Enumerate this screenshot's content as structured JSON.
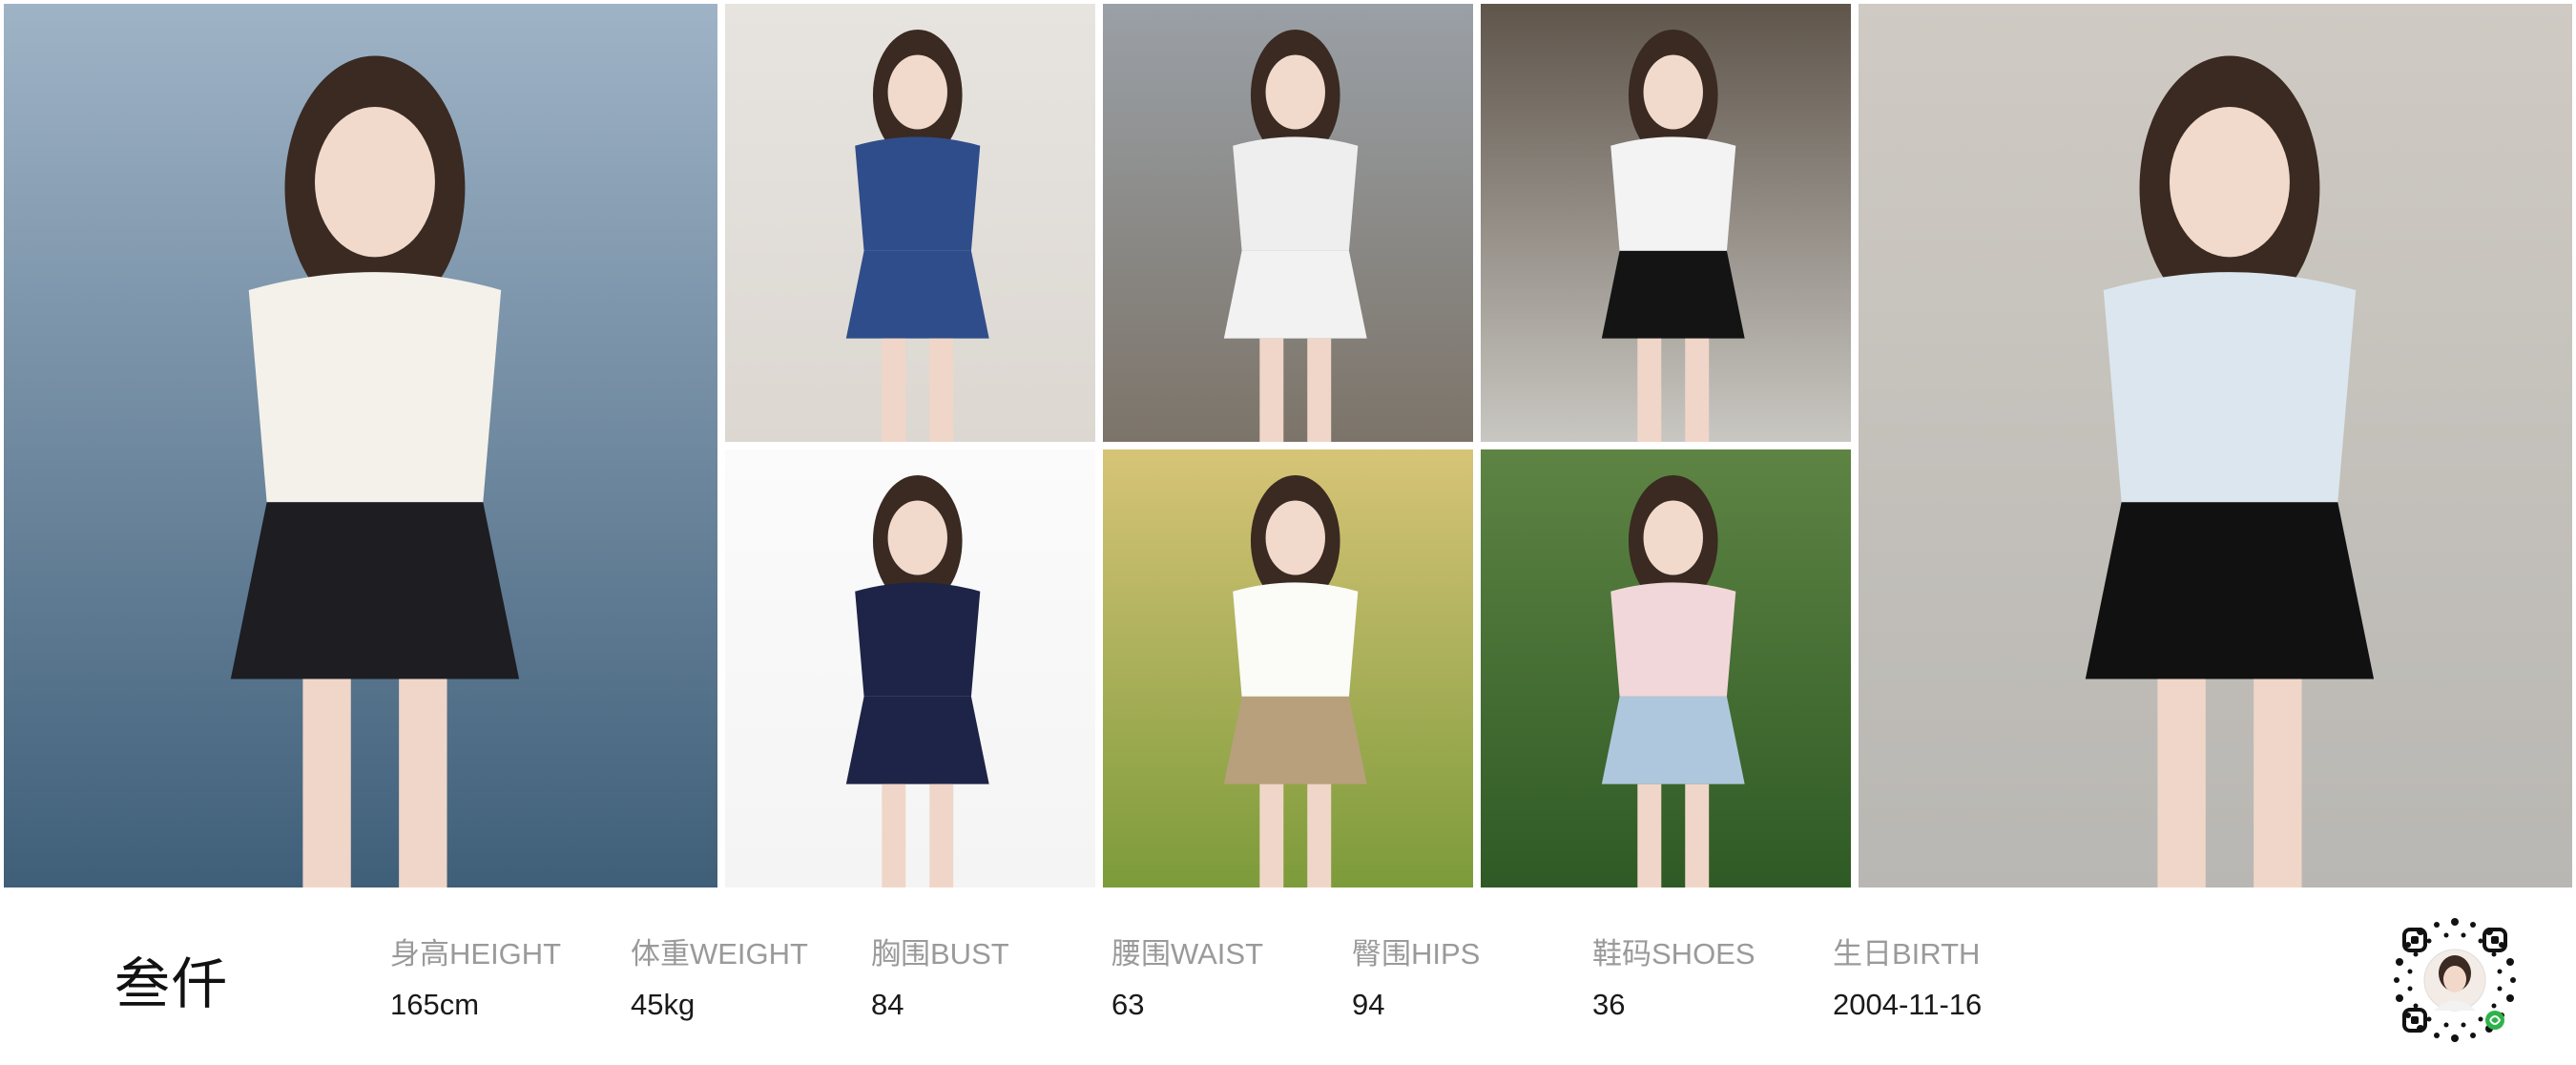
{
  "profile": {
    "name": "叁仟",
    "stats": [
      {
        "label": "身高HEIGHT",
        "value": "165cm"
      },
      {
        "label": "体重WEIGHT",
        "value": "45kg"
      },
      {
        "label": "胸围BUST",
        "value": "84"
      },
      {
        "label": "腰围WAIST",
        "value": "63"
      },
      {
        "label": "臀围HIPS",
        "value": "94"
      },
      {
        "label": "鞋码SHOES",
        "value": "36"
      },
      {
        "label": "生日BIRTH",
        "value": "2004-11-16"
      }
    ]
  },
  "photos": [
    {
      "scene": "seaside",
      "sky": "#9fb3c6",
      "ground": "#3f5f79",
      "top": "#f4f1ea",
      "bottom": "#1d1d22"
    },
    {
      "scene": "selfie",
      "sky": "#e7e4e0",
      "ground": "#dcd7d1",
      "top": "#2f4d8a",
      "bottom": "#2f4d8a"
    },
    {
      "scene": "studio",
      "sky": "#9aa0a6",
      "ground": "#7c7469",
      "top": "#eeeeee",
      "bottom": "#f2f2f2"
    },
    {
      "scene": "storefront",
      "sky": "#5f554b",
      "ground": "#c9c7c2",
      "top": "#f3f3f3",
      "bottom": "#141414"
    },
    {
      "scene": "portrait",
      "sky": "#fbfbfb",
      "ground": "#f4f4f4",
      "top": "#1d2447",
      "bottom": "#1d2447"
    },
    {
      "scene": "park",
      "sky": "#d7c477",
      "ground": "#7c9b3a",
      "top": "#fbfbf8",
      "bottom": "#b7a07b"
    },
    {
      "scene": "grass",
      "sky": "#5e8444",
      "ground": "#2f5a25",
      "top": "#f2d7da",
      "bottom": "#aec7dd"
    },
    {
      "scene": "street",
      "sky": "#cfcac3",
      "ground": "#b9b7b3",
      "top": "#dce6ee",
      "bottom": "#111111"
    }
  ],
  "qr_code": {
    "icon": "qr-code-icon"
  }
}
